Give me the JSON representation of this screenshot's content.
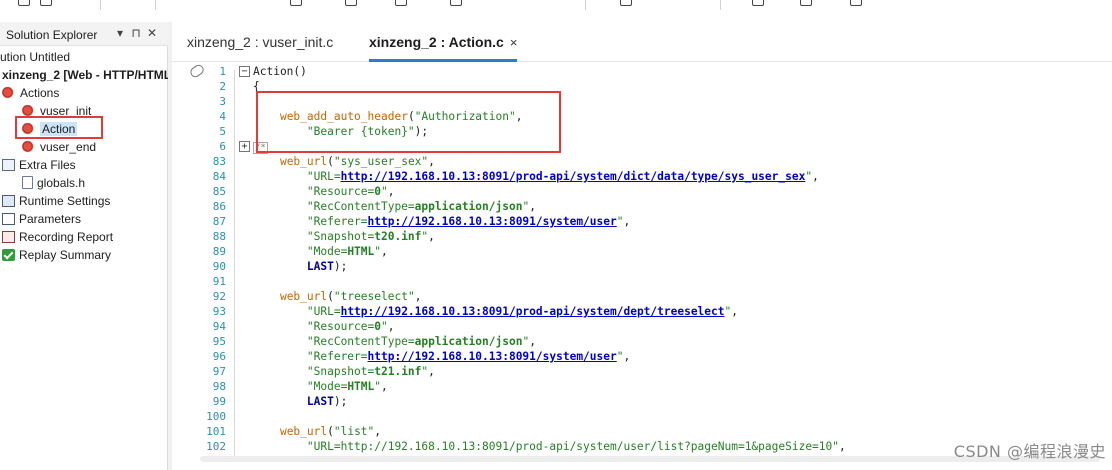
{
  "solution_explorer": {
    "title": "Solution Explorer",
    "header_buttons": [
      "▾",
      "⊓",
      "✕"
    ],
    "items": [
      {
        "label": "ution Untitled",
        "icon": "solution-icon",
        "bold": false
      },
      {
        "label": "xinzeng_2 [Web - HTTP/HTML]",
        "icon": "project-icon",
        "bold": true
      },
      {
        "label": "Actions",
        "icon": "actions-icon",
        "bold": false
      },
      {
        "label": "vuser_init",
        "icon": "action-icon",
        "bold": false
      },
      {
        "label": "Action",
        "icon": "action-icon",
        "bold": false,
        "selected": true
      },
      {
        "label": "vuser_end",
        "icon": "action-icon",
        "bold": false
      },
      {
        "label": "Extra Files",
        "icon": "folder-icon",
        "bold": false
      },
      {
        "label": "globals.h",
        "icon": "file-icon",
        "bold": false
      },
      {
        "label": "Runtime Settings",
        "icon": "settings-icon",
        "bold": false
      },
      {
        "label": "Parameters",
        "icon": "parameters-icon",
        "bold": false
      },
      {
        "label": "Recording Report",
        "icon": "report-icon",
        "bold": false
      },
      {
        "label": "Replay Summary",
        "icon": "check-icon",
        "bold": false
      }
    ]
  },
  "tabs": [
    {
      "label": "xinzeng_2 : vuser_init.c",
      "active": false
    },
    {
      "label": "xinzeng_2 : Action.c",
      "active": true,
      "close": "×"
    }
  ],
  "code_lines": [
    {
      "n": "1",
      "parts": [
        [
          "kw",
          "Action()"
        ]
      ]
    },
    {
      "n": "2",
      "parts": [
        [
          "kw",
          "{"
        ]
      ]
    },
    {
      "n": "3",
      "parts": []
    },
    {
      "n": "4",
      "parts": [
        [
          "kw",
          "    "
        ],
        [
          "fn-orange",
          "web_add_auto_header"
        ],
        [
          "kw",
          "("
        ],
        [
          "str",
          "\"Authorization\""
        ],
        [
          "kw",
          ","
        ]
      ]
    },
    {
      "n": "5",
      "parts": [
        [
          "kw",
          "        "
        ],
        [
          "str",
          "\"Bearer {token}\""
        ],
        [
          "kw",
          ");"
        ]
      ]
    },
    {
      "n": "6",
      "parts": []
    },
    {
      "n": "83",
      "parts": [
        [
          "kw",
          "    "
        ],
        [
          "fn-orange",
          "web_url"
        ],
        [
          "kw",
          "("
        ],
        [
          "str",
          "\"sys_user_sex\""
        ],
        [
          "kw",
          ","
        ]
      ]
    },
    {
      "n": "84",
      "parts": [
        [
          "kw",
          "        "
        ],
        [
          "str",
          "\"URL="
        ],
        [
          "url",
          "http://192.168.10.13:8091/prod-api/system/dict/data/type/sys_user_sex"
        ],
        [
          "str",
          "\""
        ],
        [
          "kw",
          ","
        ]
      ]
    },
    {
      "n": "85",
      "parts": [
        [
          "kw",
          "        "
        ],
        [
          "str",
          "\"Resource="
        ],
        [
          "bold-val",
          "0"
        ],
        [
          "str",
          "\""
        ],
        [
          "kw",
          ","
        ]
      ]
    },
    {
      "n": "86",
      "parts": [
        [
          "kw",
          "        "
        ],
        [
          "str",
          "\"RecContentType="
        ],
        [
          "bold-val",
          "application/json"
        ],
        [
          "str",
          "\""
        ],
        [
          "kw",
          ","
        ]
      ]
    },
    {
      "n": "87",
      "parts": [
        [
          "kw",
          "        "
        ],
        [
          "str",
          "\"Referer="
        ],
        [
          "url",
          "http://192.168.10.13:8091/system/user"
        ],
        [
          "str",
          "\""
        ],
        [
          "kw",
          ","
        ]
      ]
    },
    {
      "n": "88",
      "parts": [
        [
          "kw",
          "        "
        ],
        [
          "str",
          "\"Snapshot="
        ],
        [
          "bold-val",
          "t20.inf"
        ],
        [
          "str",
          "\""
        ],
        [
          "kw",
          ","
        ]
      ]
    },
    {
      "n": "89",
      "parts": [
        [
          "kw",
          "        "
        ],
        [
          "str",
          "\"Mode="
        ],
        [
          "bold-val",
          "HTML"
        ],
        [
          "str",
          "\""
        ],
        [
          "kw",
          ","
        ]
      ]
    },
    {
      "n": "90",
      "parts": [
        [
          "kw",
          "        "
        ],
        [
          "last",
          "LAST"
        ],
        [
          "kw",
          ");"
        ]
      ]
    },
    {
      "n": "91",
      "parts": []
    },
    {
      "n": "92",
      "parts": [
        [
          "kw",
          "    "
        ],
        [
          "fn-orange",
          "web_url"
        ],
        [
          "kw",
          "("
        ],
        [
          "str",
          "\"treeselect\""
        ],
        [
          "kw",
          ","
        ]
      ]
    },
    {
      "n": "93",
      "parts": [
        [
          "kw",
          "        "
        ],
        [
          "str",
          "\"URL="
        ],
        [
          "url",
          "http://192.168.10.13:8091/prod-api/system/dept/treeselect"
        ],
        [
          "str",
          "\""
        ],
        [
          "kw",
          ","
        ]
      ]
    },
    {
      "n": "94",
      "parts": [
        [
          "kw",
          "        "
        ],
        [
          "str",
          "\"Resource="
        ],
        [
          "bold-val",
          "0"
        ],
        [
          "str",
          "\""
        ],
        [
          "kw",
          ","
        ]
      ]
    },
    {
      "n": "95",
      "parts": [
        [
          "kw",
          "        "
        ],
        [
          "str",
          "\"RecContentType="
        ],
        [
          "bold-val",
          "application/json"
        ],
        [
          "str",
          "\""
        ],
        [
          "kw",
          ","
        ]
      ]
    },
    {
      "n": "96",
      "parts": [
        [
          "kw",
          "        "
        ],
        [
          "str",
          "\"Referer="
        ],
        [
          "url",
          "http://192.168.10.13:8091/system/user"
        ],
        [
          "str",
          "\""
        ],
        [
          "kw",
          ","
        ]
      ]
    },
    {
      "n": "97",
      "parts": [
        [
          "kw",
          "        "
        ],
        [
          "str",
          "\"Snapshot="
        ],
        [
          "bold-val",
          "t21.inf"
        ],
        [
          "str",
          "\""
        ],
        [
          "kw",
          ","
        ]
      ]
    },
    {
      "n": "98",
      "parts": [
        [
          "kw",
          "        "
        ],
        [
          "str",
          "\"Mode="
        ],
        [
          "bold-val",
          "HTML"
        ],
        [
          "str",
          "\""
        ],
        [
          "kw",
          ","
        ]
      ]
    },
    {
      "n": "99",
      "parts": [
        [
          "kw",
          "        "
        ],
        [
          "last",
          "LAST"
        ],
        [
          "kw",
          ");"
        ]
      ]
    },
    {
      "n": "100",
      "parts": []
    },
    {
      "n": "101",
      "parts": [
        [
          "kw",
          "    "
        ],
        [
          "fn-orange",
          "web_url"
        ],
        [
          "kw",
          "("
        ],
        [
          "str",
          "\"list\""
        ],
        [
          "kw",
          ","
        ]
      ]
    },
    {
      "n": "102",
      "parts": [
        [
          "kw",
          "        "
        ],
        [
          "str",
          "\"URL=http://192.168.10.13:8091/prod-api/system/user/list?pageNum=1&pageSize=10\""
        ],
        [
          "kw",
          ","
        ]
      ]
    }
  ],
  "collapsed_marker": "/*",
  "watermark": "CSDN @编程浪漫史",
  "colors": {
    "highlight_box": "#e03c3c",
    "active_tab_underline": "#2f7bd1",
    "line_numbers": "#2b91af",
    "strings": "#267f26",
    "urls": "#0000cc",
    "function_calls": "#c56700"
  }
}
